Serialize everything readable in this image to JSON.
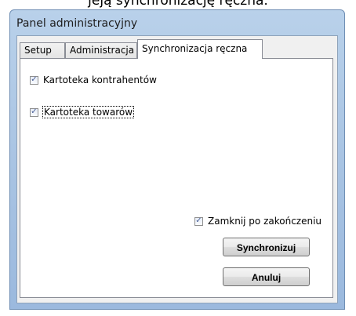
{
  "top_text": "jeją synchronizację ręczna.",
  "window": {
    "title": "Panel administracyjny"
  },
  "tabs": [
    {
      "label": "Setup"
    },
    {
      "label": "Administracja"
    },
    {
      "label": "Synchronizacja ręczna"
    }
  ],
  "checks": {
    "kontrahenci": {
      "label": "Kartoteka kontrahentów",
      "checked": true
    },
    "towary": {
      "label": "Kartoteka towarów",
      "checked": true
    },
    "zamknij": {
      "label": "Zamknij po zakończeniu",
      "checked": true
    }
  },
  "buttons": {
    "sync": "Synchronizuj",
    "cancel": "Anuluj"
  }
}
